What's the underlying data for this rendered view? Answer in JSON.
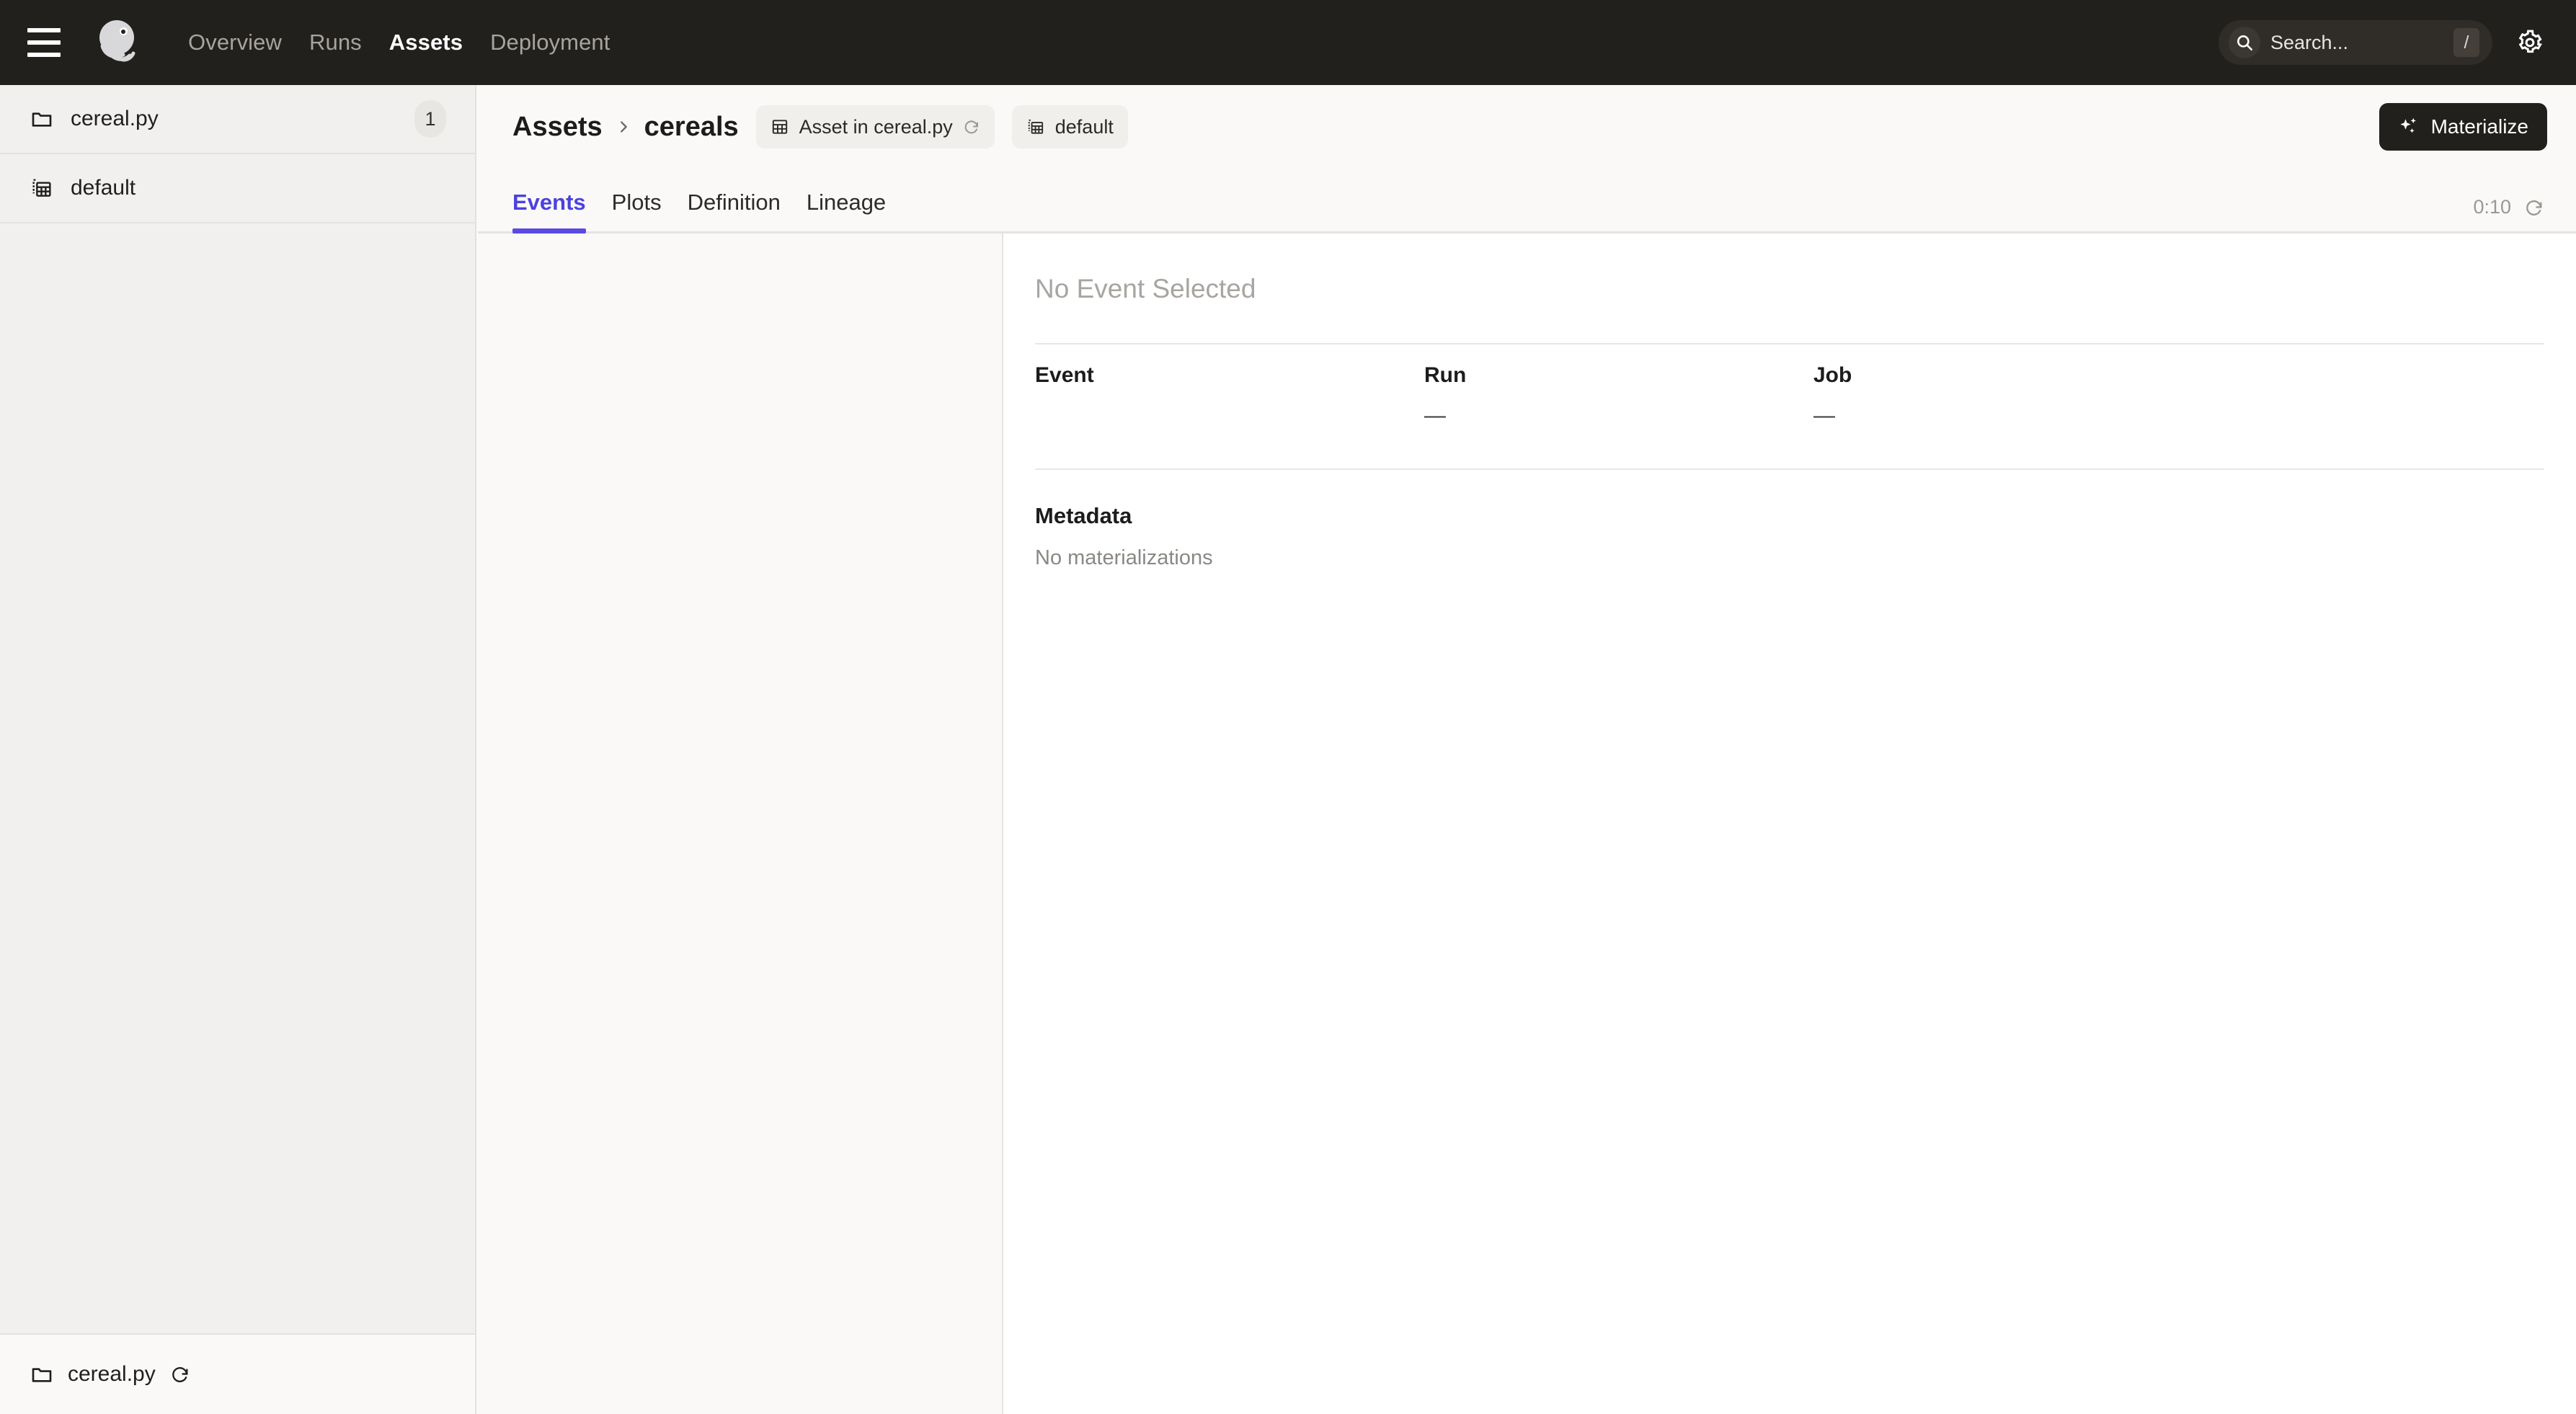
{
  "topnav": {
    "menu_icon": "hamburger-icon",
    "logo_icon": "dagster-logo-icon",
    "links": [
      {
        "label": "Overview",
        "active": false
      },
      {
        "label": "Runs",
        "active": false
      },
      {
        "label": "Assets",
        "active": true
      },
      {
        "label": "Deployment",
        "active": false
      }
    ],
    "search": {
      "placeholder": "Search...",
      "value": "",
      "shortcut": "/",
      "icon": "search-icon"
    },
    "settings_icon": "gear-icon",
    "background_color": "#22201d"
  },
  "sidebar": {
    "items": [
      {
        "label": "cereal.py",
        "icon": "folder-icon",
        "badge": "1"
      },
      {
        "label": "default",
        "icon": "table-multiple-icon",
        "badge": ""
      }
    ],
    "footer": {
      "label": "cereal.py",
      "icon": "folder-icon",
      "reload_icon": "refresh-icon"
    },
    "background_color": "#f1f0ee"
  },
  "header": {
    "breadcrumb": {
      "root": "Assets",
      "separator": "›",
      "leaf": "cereals"
    },
    "chips": [
      {
        "label": "Asset in cereal.py",
        "icon": "table-icon",
        "trailing_icon": "refresh-icon"
      },
      {
        "label": "default",
        "icon": "table-multiple-icon",
        "trailing_icon": ""
      }
    ],
    "materialize_button": {
      "label": "Materialize",
      "icon": "sparkle-icon",
      "background_color": "#22201d"
    }
  },
  "tabs": {
    "items": [
      {
        "label": "Events",
        "active": true
      },
      {
        "label": "Plots",
        "active": false
      },
      {
        "label": "Definition",
        "active": false
      },
      {
        "label": "Lineage",
        "active": false
      }
    ],
    "active_color": "#5a4ae3",
    "refresh": {
      "countdown": "0:10",
      "icon": "refresh-icon"
    }
  },
  "events_panel": {
    "items": []
  },
  "detail": {
    "title": "No Event Selected",
    "columns": [
      {
        "header": "Event",
        "value": ""
      },
      {
        "header": "Run",
        "value": "—"
      },
      {
        "header": "Job",
        "value": "—"
      }
    ],
    "metadata": {
      "title": "Metadata",
      "empty_text": "No materializations"
    }
  }
}
